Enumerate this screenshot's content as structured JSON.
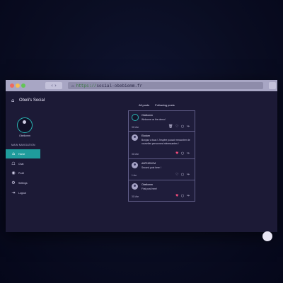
{
  "browser": {
    "nav_label": "‹ ›",
    "url_scheme": "https://",
    "url_host": "social-obebiemm.fr",
    "lock_icon": "lock-icon"
  },
  "sidebar": {
    "brand": "Obeli's Social",
    "profile_name": "Obeliomm",
    "nav_heading": "MAIN NAVIGATION",
    "items": [
      {
        "label": "Home",
        "icon": "home-icon",
        "active": true
      },
      {
        "label": "Chat",
        "icon": "chat-icon",
        "active": false
      },
      {
        "label": "Profil",
        "icon": "user-icon",
        "active": false
      },
      {
        "label": "Settings",
        "icon": "gear-icon",
        "active": false
      },
      {
        "label": "Logout",
        "icon": "logout-icon",
        "active": false
      }
    ]
  },
  "feed": {
    "tabs": [
      "All posts",
      "Following posts"
    ],
    "posts": [
      {
        "author": "Obeliomm",
        "text": "Welcome on the demo!",
        "date": "31 Mar",
        "avatar": "teal-ring",
        "liked": false
      },
      {
        "author": "Elodum",
        "text": "Bonjour à tous ! J'espère pouvoir rencontrer de nouvelles personnes intéressantes !",
        "date": "31 Mar",
        "avatar": "person",
        "liked": true
      },
      {
        "author": "ANTHONYM",
        "text": "Second post here !",
        "date": "1 Avr",
        "avatar": "person",
        "liked": false
      },
      {
        "author": "Obeliomm",
        "text": "First post here!",
        "date": "31 Mar",
        "avatar": "person",
        "liked": true
      }
    ]
  },
  "colors": {
    "accent": "#1f9c9c",
    "like": "#ef4b7a",
    "background": "#1c1a36"
  }
}
